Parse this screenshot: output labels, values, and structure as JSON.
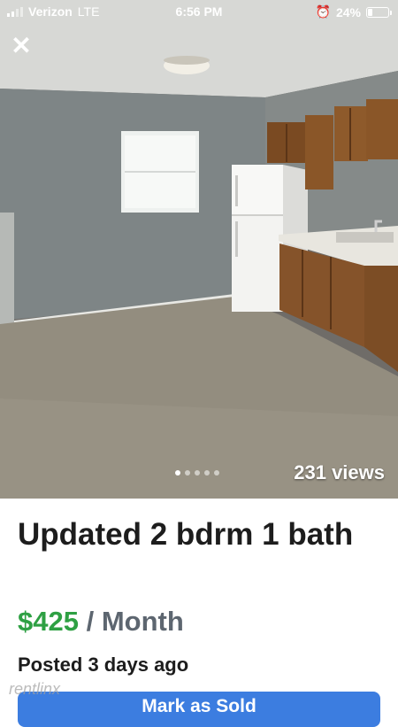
{
  "status_bar": {
    "carrier": "Verizon",
    "network": "LTE",
    "time": "6:56 PM",
    "battery_percent_label": "24%",
    "battery_level": 0.24,
    "alarm_icon": "alarm-clock-icon"
  },
  "listing": {
    "photo_count": 5,
    "active_photo_index": 0,
    "views_label": "231 views",
    "title": "Updated 2 bdrm 1 bath",
    "price": "$425",
    "price_period": "/ Month",
    "posted": "Posted 3 days ago",
    "watermark": "rentlinx",
    "action_button_label": "Mark as Sold"
  },
  "colors": {
    "price_green": "#2ea043",
    "button_blue": "#3c7de0",
    "title_text": "#1d1d1d",
    "period_gray": "#5d6670"
  },
  "icons": {
    "close": "close-icon",
    "signal": "signal-bars-icon",
    "battery": "battery-icon"
  }
}
